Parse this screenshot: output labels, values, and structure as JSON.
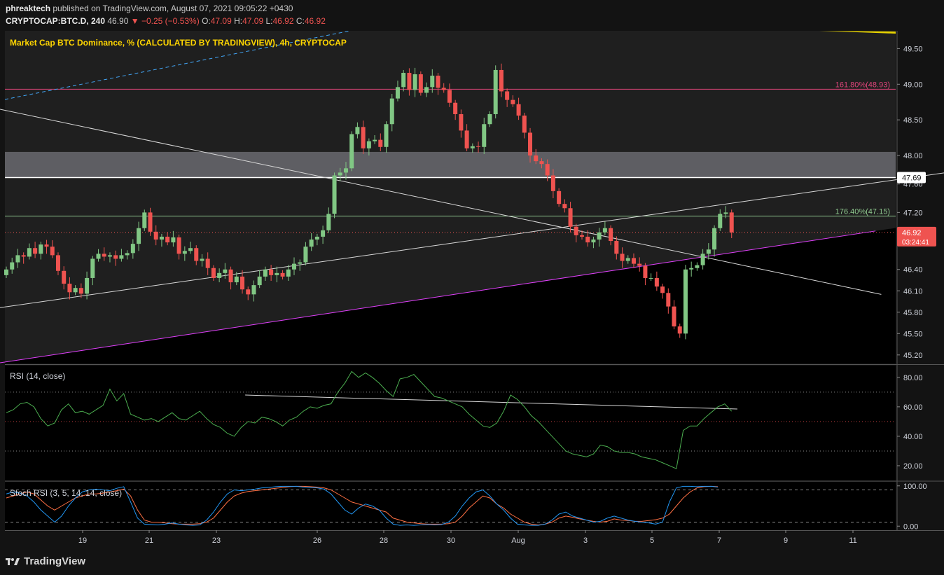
{
  "header": {
    "author": "phreaktech",
    "published_text": "published on TradingView.com, August 07, 2021 09:05:22 +0430",
    "symbol": "CRYPTOCAP:BTC.D, 240",
    "last": "46.90",
    "arrow": "▼",
    "change": "−0.25 (−0.53%)",
    "o_label": "O:",
    "o": "47.09",
    "h_label": "H:",
    "h": "47.09",
    "l_label": "L:",
    "l": "46.92",
    "c_label": "C:",
    "c": "46.92"
  },
  "footer": {
    "brand": "TradingView"
  },
  "chart_data": [
    {
      "type": "candlestick",
      "title": "Market Cap BTC Dominance, % (CALCULATED BY TRADINGVIEW), 4h, CRYPTOCAP",
      "yticks": [
        "49.50",
        "49.00",
        "48.50",
        "48.00",
        "47.60",
        "47.20",
        "46.80",
        "46.40",
        "46.10",
        "45.80",
        "45.50",
        "45.20"
      ],
      "ylim": [
        45.08,
        49.75
      ],
      "xticks": [
        "19",
        "21",
        "23",
        "26",
        "28",
        "30",
        "Aug",
        "3",
        "5",
        "7",
        "9",
        "11"
      ],
      "price_label": {
        "value": "46.92",
        "countdown": "03:24:41",
        "color": "#ef5350"
      },
      "level_label": {
        "value": "47.69"
      },
      "fib_levels": [
        {
          "label": "161.80%(48.93)",
          "value": 48.93,
          "color": "#e0457b"
        },
        {
          "label": "176.40%(47.15)",
          "value": 47.15,
          "color": "#8fc98f"
        }
      ],
      "zone": {
        "from": 47.69,
        "to": 48.05
      },
      "current_price_line": 46.92,
      "colors": {
        "up": "#81c784",
        "down": "#ef5350",
        "support_line": "#e040fb",
        "dashed_line": "#42a5f5"
      },
      "candles_close": [
        46.4,
        46.5,
        46.6,
        46.58,
        46.7,
        46.62,
        46.75,
        46.72,
        46.6,
        46.38,
        46.2,
        46.08,
        46.14,
        46.06,
        46.28,
        46.55,
        46.62,
        46.58,
        46.6,
        46.55,
        46.6,
        46.63,
        46.76,
        46.98,
        47.2,
        46.93,
        46.82,
        46.86,
        46.78,
        46.85,
        46.62,
        46.66,
        46.7,
        46.52,
        46.55,
        46.42,
        46.28,
        46.35,
        46.4,
        46.22,
        46.3,
        46.12,
        46.05,
        46.18,
        46.3,
        46.4,
        46.32,
        46.35,
        46.3,
        46.4,
        46.48,
        46.5,
        46.72,
        46.82,
        46.86,
        46.95,
        47.18,
        47.72,
        47.76,
        47.82,
        48.3,
        48.4,
        48.1,
        48.2,
        48.22,
        48.12,
        48.44,
        48.8,
        48.96,
        49.16,
        48.92,
        49.14,
        48.88,
        48.96,
        49.12,
        48.95,
        48.92,
        48.74,
        48.58,
        48.35,
        48.1,
        48.13,
        48.12,
        48.44,
        48.58,
        49.2,
        48.9,
        48.78,
        48.72,
        48.56,
        48.32,
        48.0,
        47.92,
        47.88,
        47.72,
        47.5,
        47.32,
        47.26,
        47.0,
        46.88,
        46.86,
        46.78,
        46.82,
        46.92,
        46.98,
        46.8,
        46.62,
        46.52,
        46.56,
        46.48,
        46.45,
        46.28,
        46.28,
        46.16,
        46.07,
        45.88,
        45.6,
        45.5,
        46.4,
        46.42,
        46.46,
        46.62,
        46.68,
        46.98,
        47.18,
        47.2,
        46.92
      ],
      "support_line": {
        "from": [
          -6,
          45.03
        ],
        "to": [
          151.0,
          46.94
        ]
      },
      "resistance_line": {
        "from": [
          -11,
          45.75
        ],
        "to": [
          165.0,
          47.78
        ]
      },
      "down_line": {
        "from": [
          -10,
          48.8
        ],
        "to": [
          152.0,
          46.05
        ]
      }
    },
    {
      "type": "line",
      "title": "RSI (14, close)",
      "yticks": [
        "80.00",
        "60.00",
        "40.00",
        "20.00"
      ],
      "ylim": [
        10,
        88
      ],
      "bands": [
        70,
        50,
        30
      ],
      "series": [
        {
          "values": [
            56,
            58,
            62,
            63,
            60,
            52,
            47,
            49,
            58,
            62,
            56,
            57,
            55,
            58,
            61,
            72,
            64,
            69,
            55,
            53,
            51,
            52,
            50,
            53,
            56,
            52,
            51,
            54,
            57,
            52,
            48,
            46,
            42,
            40,
            46,
            50,
            49,
            53,
            52,
            50,
            47,
            51,
            53,
            57,
            60,
            59,
            61,
            62,
            70,
            76,
            84,
            80,
            83,
            80,
            76,
            71,
            67,
            79,
            80,
            82,
            77,
            72,
            67,
            66,
            64,
            62,
            60,
            55,
            51,
            47,
            46,
            49,
            57,
            68,
            65,
            60,
            54,
            50,
            45,
            40,
            35,
            30,
            28,
            27,
            26,
            28,
            34,
            33,
            30,
            29,
            29,
            28,
            26,
            25,
            24,
            22,
            20,
            18,
            44,
            47,
            47,
            52,
            56,
            60,
            62,
            57
          ]
        }
      ],
      "trend_line": {
        "from": [
          41.5,
          68.0
        ],
        "to": [
          127.0,
          58.5
        ]
      },
      "colors": {
        "line": "#4caf50",
        "trend": "#d8d8d8"
      }
    },
    {
      "type": "line",
      "title": "Stoch RSI (3, 5, 14, 14, close)",
      "yticks": [
        "100.00",
        "0.00"
      ],
      "ylim": [
        -10,
        110
      ],
      "bands": [
        90,
        10
      ],
      "series": [
        {
          "values": [
            70,
            75,
            80,
            85,
            80,
            65,
            50,
            40,
            50,
            60,
            70,
            75,
            80,
            80,
            82,
            85,
            88,
            92,
            75,
            40,
            15,
            10,
            10,
            8,
            6,
            5,
            5,
            5,
            6,
            10,
            20,
            40,
            60,
            75,
            82,
            86,
            88,
            90,
            92,
            94,
            96,
            98,
            99,
            99,
            98,
            97,
            95,
            90,
            80,
            70,
            60,
            55,
            50,
            45,
            40,
            35,
            20,
            15,
            10,
            8,
            6,
            5,
            5,
            5,
            6,
            10,
            25,
            45,
            60,
            75,
            70,
            55,
            45,
            30,
            20,
            10,
            5,
            3,
            5,
            10,
            20,
            25,
            22,
            18,
            15,
            12,
            10,
            12,
            18,
            15,
            14,
            12,
            12,
            14,
            16,
            20,
            30,
            50,
            70,
            85,
            95,
            98,
            99,
            98
          ],
          "color": "#ff7043"
        },
        {
          "values": [
            80,
            85,
            82,
            75,
            60,
            40,
            25,
            10,
            25,
            50,
            70,
            85,
            90,
            92,
            90,
            88,
            94,
            98,
            60,
            20,
            5,
            4,
            3,
            5,
            8,
            5,
            3,
            2,
            3,
            15,
            35,
            60,
            80,
            90,
            88,
            90,
            92,
            95,
            96,
            98,
            99,
            99,
            99,
            97,
            96,
            95,
            92,
            80,
            60,
            40,
            30,
            45,
            55,
            50,
            40,
            20,
            5,
            2,
            3,
            2,
            3,
            4,
            3,
            4,
            10,
            25,
            50,
            70,
            85,
            90,
            75,
            55,
            40,
            20,
            5,
            3,
            2,
            2,
            5,
            15,
            30,
            35,
            25,
            20,
            15,
            10,
            12,
            20,
            25,
            20,
            15,
            12,
            10,
            8,
            5,
            10,
            60,
            95,
            99,
            99,
            98,
            99,
            99,
            97
          ],
          "color": "#2196f3"
        }
      ]
    }
  ]
}
